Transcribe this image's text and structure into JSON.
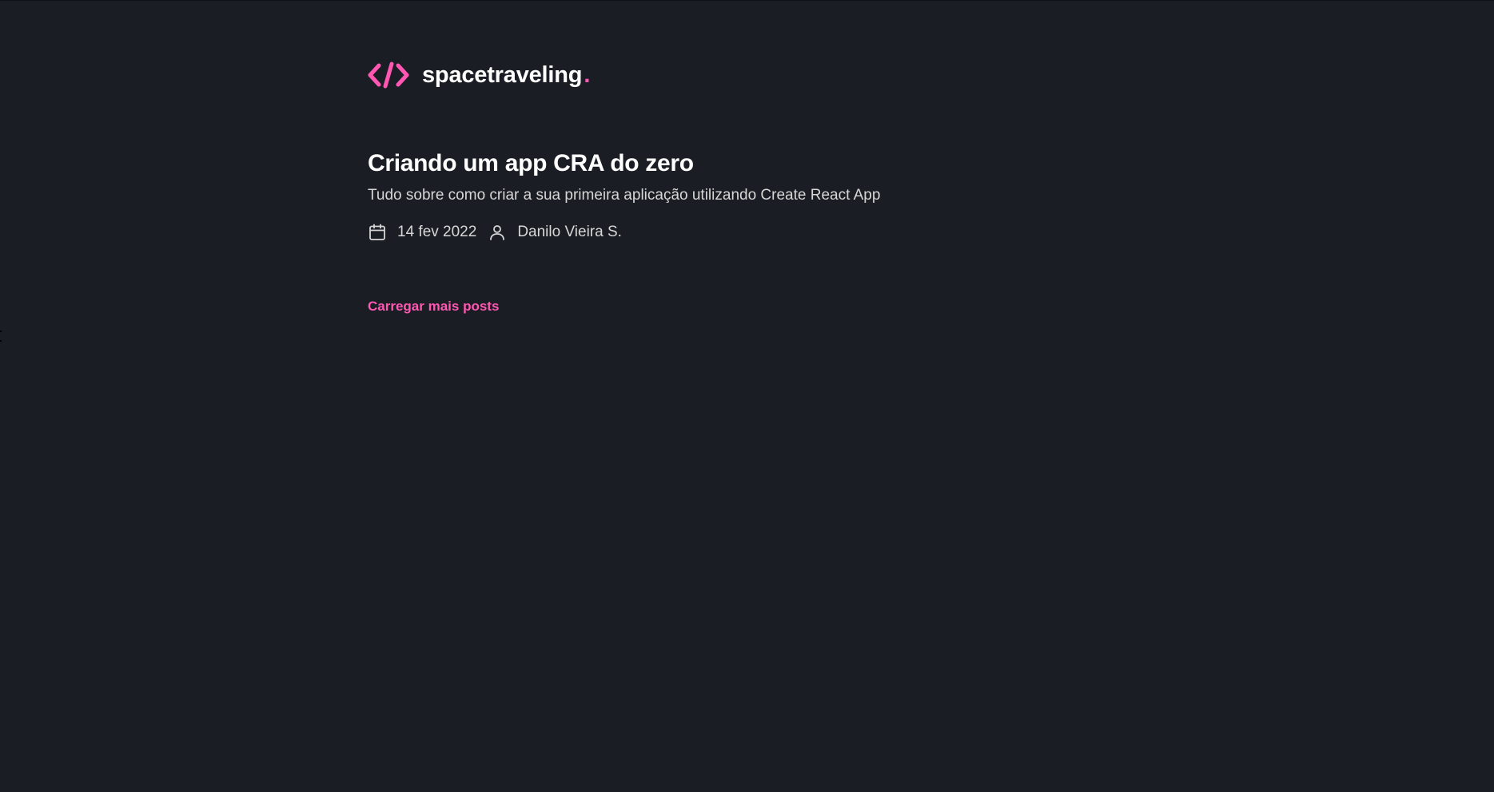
{
  "colors": {
    "background": "#1a1d23",
    "accent": "#ff57b2",
    "heading": "#ffffff",
    "body_text": "#d7d7d7"
  },
  "header": {
    "logo_icon": "code-brackets-icon",
    "brand_name": "spacetraveling",
    "brand_dot": "."
  },
  "posts": [
    {
      "title": "Criando um app CRA do zero",
      "subtitle": "Tudo sobre como criar a sua primeira aplicação utilizando Create React App",
      "date_icon": "calendar-icon",
      "date": "14 fev 2022",
      "author_icon": "user-icon",
      "author": "Danilo Vieira S."
    }
  ],
  "actions": {
    "load_more_label": "Carregar mais posts"
  }
}
